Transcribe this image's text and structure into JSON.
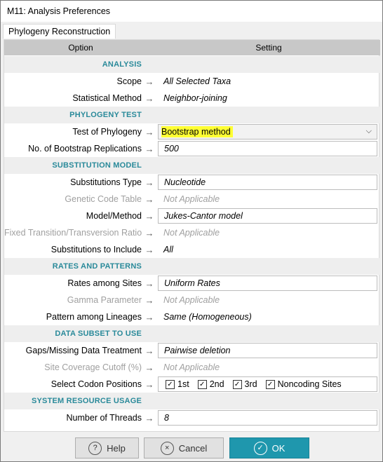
{
  "window": {
    "title": "M11: Analysis Preferences"
  },
  "tab": {
    "label": "Phylogeny Reconstruction"
  },
  "grid": {
    "header_option": "Option",
    "header_setting": "Setting"
  },
  "rows": [
    {
      "type": "section",
      "title": "ANALYSIS"
    },
    {
      "type": "row",
      "label": "Scope",
      "value": "All Selected Taxa",
      "style": "plain"
    },
    {
      "type": "row",
      "label": "Statistical Method",
      "value": "Neighbor-joining",
      "style": "plain"
    },
    {
      "type": "section",
      "title": "PHYLOGENY TEST"
    },
    {
      "type": "row",
      "label": "Test of Phylogeny",
      "value": "Bootstrap method",
      "style": "select"
    },
    {
      "type": "row",
      "label": "No. of Bootstrap Replications",
      "value": "500",
      "style": "boxed"
    },
    {
      "type": "section",
      "title": "SUBSTITUTION MODEL"
    },
    {
      "type": "row",
      "label": "Substitutions Type",
      "value": "Nucleotide",
      "style": "boxed"
    },
    {
      "type": "row",
      "label": "Genetic Code Table",
      "value": "Not Applicable",
      "style": "plain",
      "disabled": true
    },
    {
      "type": "row",
      "label": "Model/Method",
      "value": "Jukes-Cantor model",
      "style": "boxed"
    },
    {
      "type": "row",
      "label": "Fixed Transition/Transversion Ratio",
      "value": "Not Applicable",
      "style": "plain",
      "disabled": true
    },
    {
      "type": "row",
      "label": "Substitutions to Include",
      "value": "All",
      "style": "plain"
    },
    {
      "type": "section",
      "title": "RATES AND PATTERNS"
    },
    {
      "type": "row",
      "label": "Rates among Sites",
      "value": "Uniform Rates",
      "style": "boxed"
    },
    {
      "type": "row",
      "label": "Gamma Parameter",
      "value": "Not Applicable",
      "style": "plain",
      "disabled": true
    },
    {
      "type": "row",
      "label": "Pattern among Lineages",
      "value": "Same (Homogeneous)",
      "style": "plain"
    },
    {
      "type": "section",
      "title": "DATA SUBSET TO USE"
    },
    {
      "type": "row",
      "label": "Gaps/Missing Data Treatment",
      "value": "Pairwise deletion",
      "style": "boxed"
    },
    {
      "type": "row",
      "label": "Site Coverage Cutoff (%)",
      "value": "Not Applicable",
      "style": "plain",
      "disabled": true
    },
    {
      "type": "row",
      "label": "Select Codon Positions",
      "style": "codons",
      "options": [
        {
          "label": "1st",
          "checked": true
        },
        {
          "label": "2nd",
          "checked": true
        },
        {
          "label": "3rd",
          "checked": true
        },
        {
          "label": "Noncoding Sites",
          "checked": true
        }
      ]
    },
    {
      "type": "section",
      "title": "SYSTEM RESOURCE USAGE"
    },
    {
      "type": "row",
      "label": "Number of Threads",
      "value": "8",
      "style": "boxed"
    }
  ],
  "buttons": {
    "help": {
      "label": "Help",
      "icon": "?"
    },
    "cancel": {
      "label": "Cancel",
      "icon": "×"
    },
    "ok": {
      "label": "OK",
      "icon": "✓"
    }
  },
  "colors": {
    "section_title": "#2a8a9a",
    "highlight": "#ffff33",
    "ok_button": "#1f97ad"
  }
}
